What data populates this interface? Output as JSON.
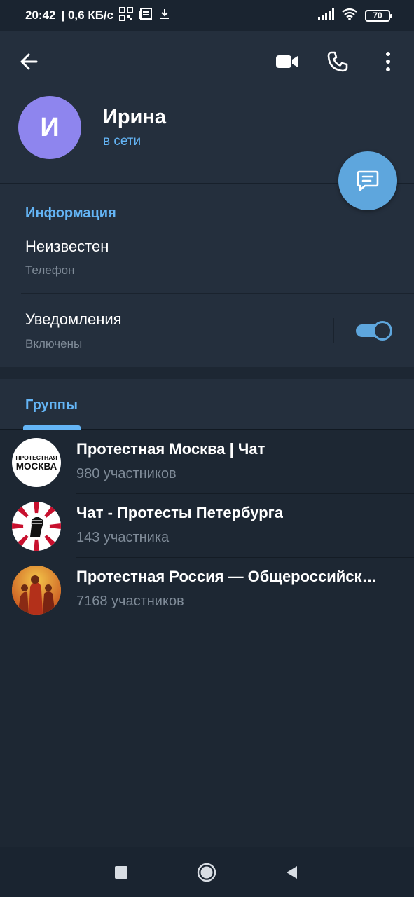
{
  "status_bar": {
    "time": "20:42",
    "speed": "| 0,6 КБ/с",
    "battery": "70"
  },
  "header": {
    "avatar_letter": "И",
    "name": "Ирина",
    "status": "в сети",
    "accent_color": "#64b5f6",
    "avatar_color": "#8e85ee"
  },
  "info": {
    "title": "Информация",
    "phone_value": "Неизвестен",
    "phone_label": "Телефон",
    "notifications_title": "Уведомления",
    "notifications_state": "Включены",
    "notifications_enabled": true
  },
  "groups": {
    "tab_label": "Группы",
    "items": [
      {
        "name": "Протестная Москва | Чат",
        "count": "980 участников",
        "avatar_text_1": "ПРОТЕСТНАЯ",
        "avatar_text_2": "МОСКВА"
      },
      {
        "name": "Чат - Протесты Петербурга",
        "count": "143 участника"
      },
      {
        "name": "Протестная Россия — Общероссийск…",
        "count": "7168 участников"
      }
    ]
  }
}
